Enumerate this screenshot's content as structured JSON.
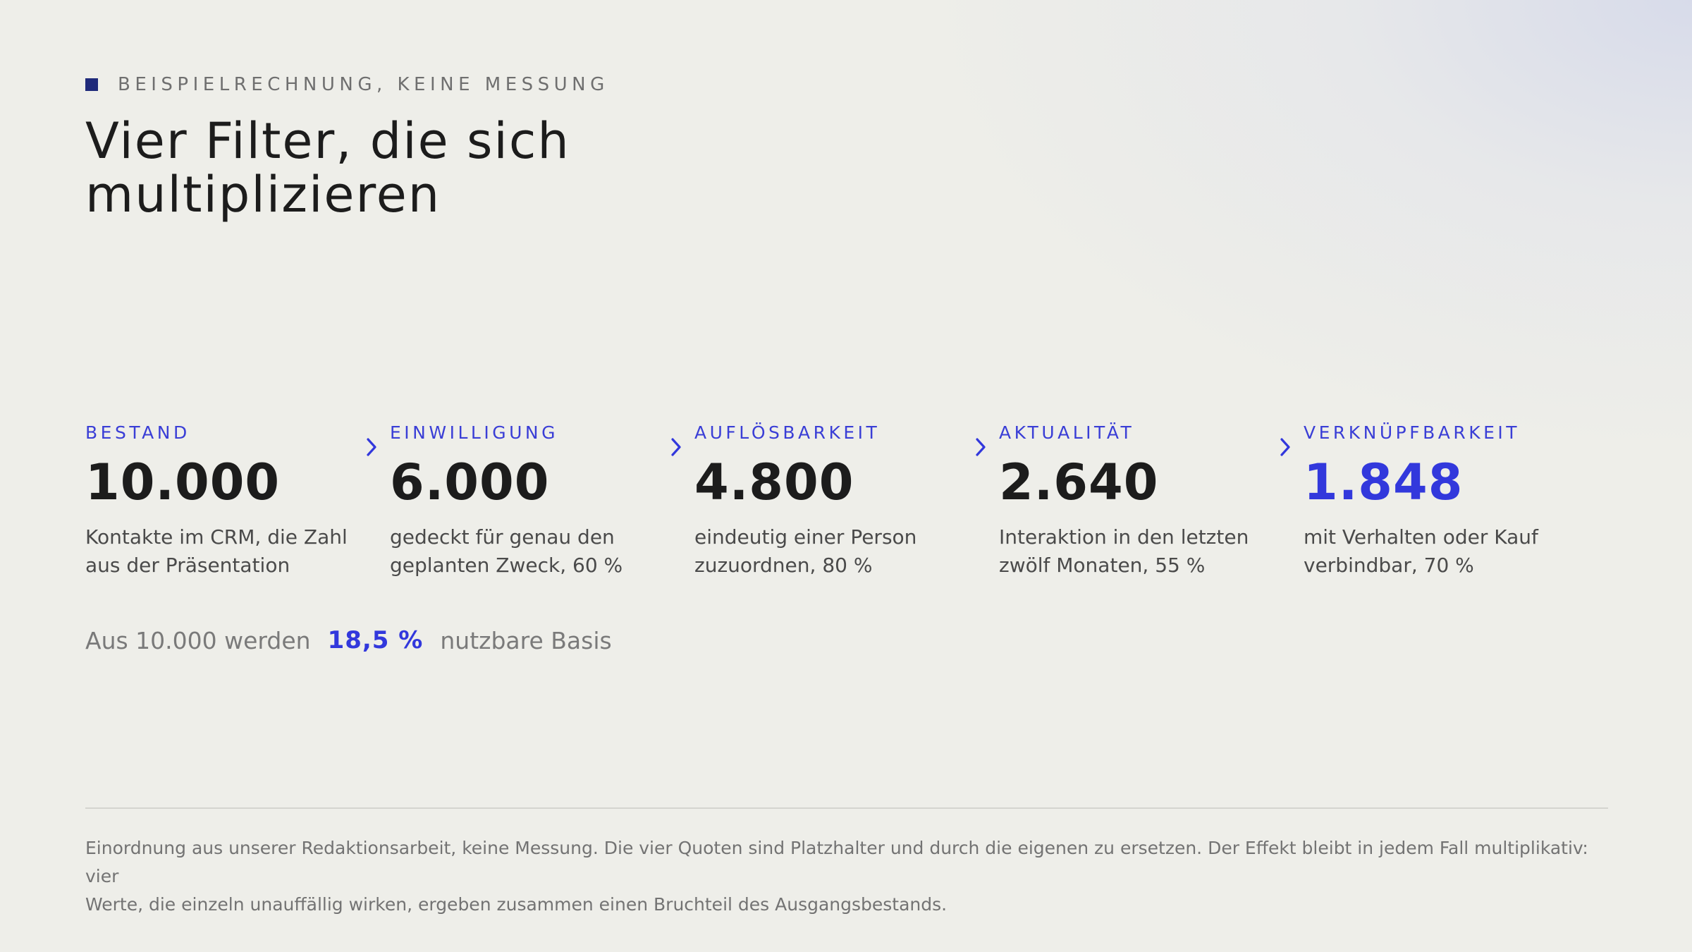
{
  "eyebrow": {
    "text": "BEISPIELRECHNUNG, KEINE MESSUNG"
  },
  "headline": {
    "line1": "Vier Filter, die sich",
    "line2": "multiplizieren"
  },
  "steps": [
    {
      "label": "BESTAND",
      "value": "10.000",
      "desc_line1": "Kontakte im CRM, die Zahl",
      "desc_line2": "aus der Präsentation"
    },
    {
      "label": "EINWILLIGUNG",
      "value": "6.000",
      "desc_line1": "gedeckt für genau den",
      "desc_line2": "geplanten Zweck, 60 %"
    },
    {
      "label": "AUFLÖSBARKEIT",
      "value": "4.800",
      "desc_line1": "eindeutig einer Person",
      "desc_line2": "zuzuordnen, 80 %"
    },
    {
      "label": "AKTUALITÄT",
      "value": "2.640",
      "desc_line1": "Interaktion in den letzten",
      "desc_line2": "zwölf Monaten, 55 %"
    },
    {
      "label": "VERKNÜPFBARKEIT",
      "value": "1.848",
      "desc_line1": "mit Verhalten oder Kauf",
      "desc_line2": "verbindbar, 70 %"
    }
  ],
  "summary": {
    "prefix": "Aus 10.000 werden",
    "percent": "18,5 %",
    "suffix": "nutzbare Basis"
  },
  "footnote": {
    "line1": "Einordnung aus unserer Redaktionsarbeit, keine Messung. Die vier Quoten sind Platzhalter und durch die eigenen zu ersetzen. Der Effekt bleibt in jedem Fall multiplikativ: vier",
    "line2": "Werte, die einzeln unauffällig wirken, ergeben zusammen einen Bruchteil des Ausgangsbestands."
  },
  "colors": {
    "accent": "#3238dc",
    "eyebrow_square": "#1f2a7a",
    "text": "#1c1c1c",
    "muted": "#737373",
    "background": "#eeeee9"
  },
  "icons": {
    "arrow": "chevron-right-icon"
  }
}
